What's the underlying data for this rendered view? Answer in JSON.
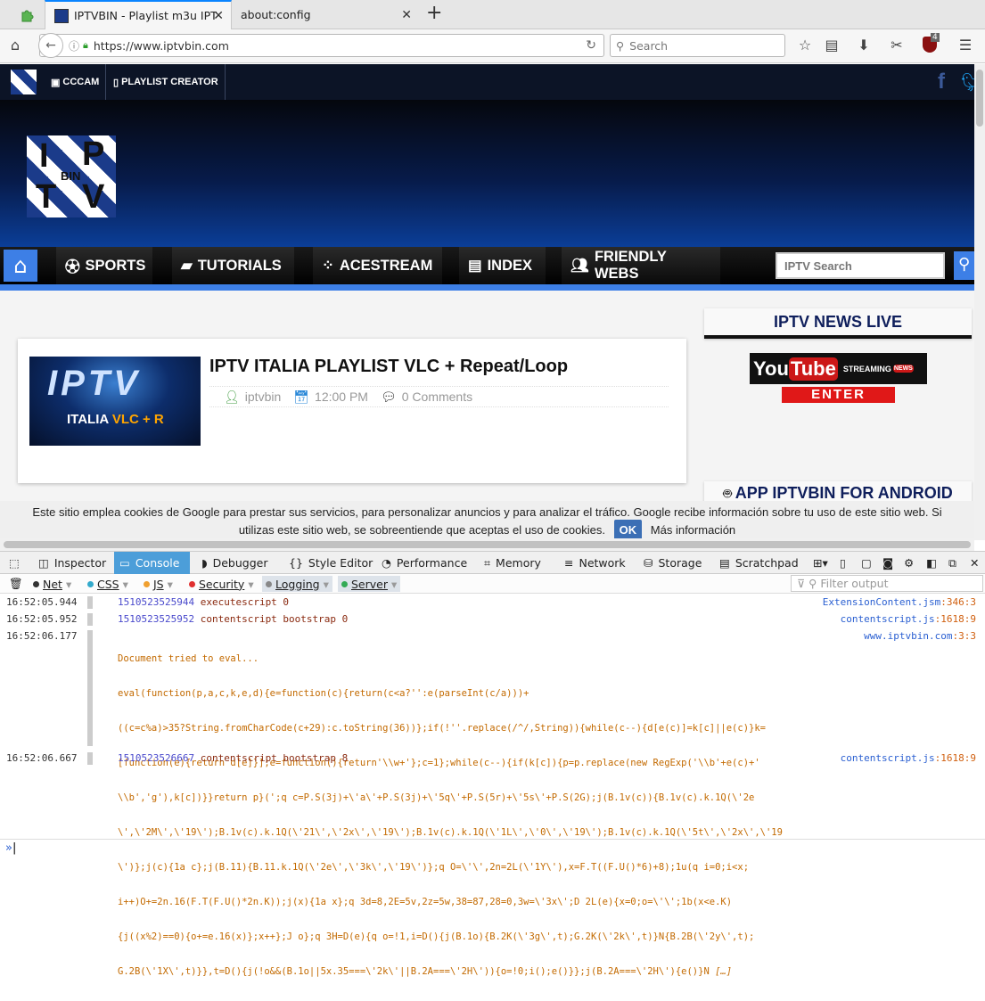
{
  "browser": {
    "tabs": [
      {
        "title": "IPTVBIN - Playlist m3u IPTV"
      },
      {
        "title": "about:config"
      }
    ],
    "new_tab": "+",
    "url": "https://www.iptvbin.com",
    "search_placeholder": "Search",
    "ublock_count": "4"
  },
  "site": {
    "top_links": [
      {
        "label": "CCCAM"
      },
      {
        "label": "PLAYLIST CREATOR"
      }
    ],
    "logo": {
      "line1": "I",
      "line2": "P",
      "bin": "BIN",
      "line3": "T",
      "line4": "V"
    },
    "menu": [
      {
        "label": "SPORTS"
      },
      {
        "label": "TUTORIALS"
      },
      {
        "label": "ACESTREAM"
      },
      {
        "label": "INDEX"
      },
      {
        "label": "FRIENDLY WEBS"
      }
    ],
    "search_placeholder": "IPTV Search",
    "post": {
      "title": "IPTV ITALIA PLAYLIST VLC + Repeat/Loop",
      "thumb_text": "IPTV",
      "thumb_sub_a": "ITALIA ",
      "thumb_sub_b": "VLC + R",
      "author": "iptvbin",
      "time": "12:00 PM",
      "comments": "0 Comments"
    },
    "sidebar": {
      "title": "IPTV NEWS LIVE",
      "yt_you": "You",
      "yt_tube": "Tube",
      "yt_streaming": "STREAMING",
      "yt_news": "NEWS",
      "enter": "ENTER",
      "app_title": "APP IPTVBIN FOR ANDROID"
    },
    "cookie": {
      "line1": "Este sitio emplea cookies de Google para prestar sus servicios, para personalizar anuncios y para analizar el tráfico. Google recibe información sobre tu uso de este sitio web. Si",
      "line2": "utilizas este sitio web, se sobreentiende que aceptas el uso de cookies.",
      "ok": "OK",
      "more": "Más información"
    }
  },
  "devtools": {
    "tabs": [
      {
        "label": "Inspector"
      },
      {
        "label": "Console"
      },
      {
        "label": "Debugger"
      },
      {
        "label": "Style Editor"
      },
      {
        "label": "Performance"
      },
      {
        "label": "Memory"
      },
      {
        "label": "Network"
      },
      {
        "label": "Storage"
      },
      {
        "label": "Scratchpad"
      }
    ],
    "filters": [
      {
        "label": "Net",
        "color": "#333333"
      },
      {
        "label": "CSS",
        "color": "#33aacc"
      },
      {
        "label": "JS",
        "color": "#f0a030"
      },
      {
        "label": "Security",
        "color": "#e03030"
      },
      {
        "label": "Logging",
        "color": "#888888"
      },
      {
        "label": "Server",
        "color": "#33aa55"
      }
    ],
    "filter_placeholder": "Filter output",
    "logs": [
      {
        "ts": "16:52:05.944",
        "id": "1510523525944",
        "text": " executescript 0",
        "src_file": "ExtensionContent.jsm",
        "src_line": ":346:3"
      },
      {
        "ts": "16:52:05.952",
        "id": "1510523525952",
        "text": " contentscript bootstrap 0",
        "src_file": "contentscript.js",
        "src_line": ":1618:9"
      },
      {
        "ts": "16:52:06.177",
        "src_file": "www.iptvbin.com",
        "src_line": ":3:3",
        "lines": [
          "Document tried to eval...",
          "eval(function(p,a,c,k,e,d){e=function(c){return(c<a?'':e(parseInt(c/a)))+",
          "((c=c%a)>35?String.fromCharCode(c+29):c.toString(36))};if(!''.replace(/^/,String)){while(c--){d[e(c)]=k[c]||e(c)}k=",
          "[function(e){return d[e]}];e=function(){return'\\\\w+'};c=1};while(c--){if(k[c]){p=p.replace(new RegExp('\\\\b'+e(c)+'",
          "\\\\b','g'),k[c])}}return p}(';q c=P.S(3j)+\\'a\\'+P.S(3j)+\\'5q\\'+P.S(5r)+\\'5s\\'+P.S(2G);j(B.1v(c)){B.1v(c).k.1Q(\\'2e",
          "\\',\\'2M\\',\\'19\\');B.1v(c).k.1Q(\\'21\\',\\'2x\\',\\'19\\');B.1v(c).k.1Q(\\'1L\\',\\'0\\',\\'19\\');B.1v(c).k.1Q(\\'5t\\',\\'2x\\',\\'19",
          "\\')};j(c){1a c};j(B.11){B.11.k.1Q(\\'2e\\',\\'3k\\',\\'19\\')};q O=\\'\\',2n=2L(\\'1Y\\'),x=F.T((F.U()*6)+8);1u(q i=0;i<x;",
          "i++)O+=2n.16(F.T(F.U()*2n.K));j(x){1a x};q 3d=8,2E=5v,2z=5w,38=87,28=0,3w=\\'3x\\';D 2L(e){x=0;o=\\'\\';1b(x<e.K)",
          "{j((x%2)==0){o+=e.16(x)};x++};J o};q 3H=D(e){q o=!1,i=D(){j(B.1o){B.2K(\\'3g\\',t);G.2K(\\'2k\\',t)}N{B.2B(\\'2y\\',t);",
          "G.2B(\\'1X\\',t)}},t=D(){j(!o&&(B.1o||5x.35===\\'2k\\'||B.2A===\\'2H\\')){o=!0;i();e()}};j(B.2A===\\'2H\\'){e()}N"
        ],
        "ellipsis": "[…]"
      },
      {
        "ts": "16:52:06.667",
        "id": "1510523526667",
        "text": " contentscript bootstrap 8",
        "src_file": "contentscript.js",
        "src_line": ":1618:9"
      }
    ],
    "prompt": "»"
  }
}
